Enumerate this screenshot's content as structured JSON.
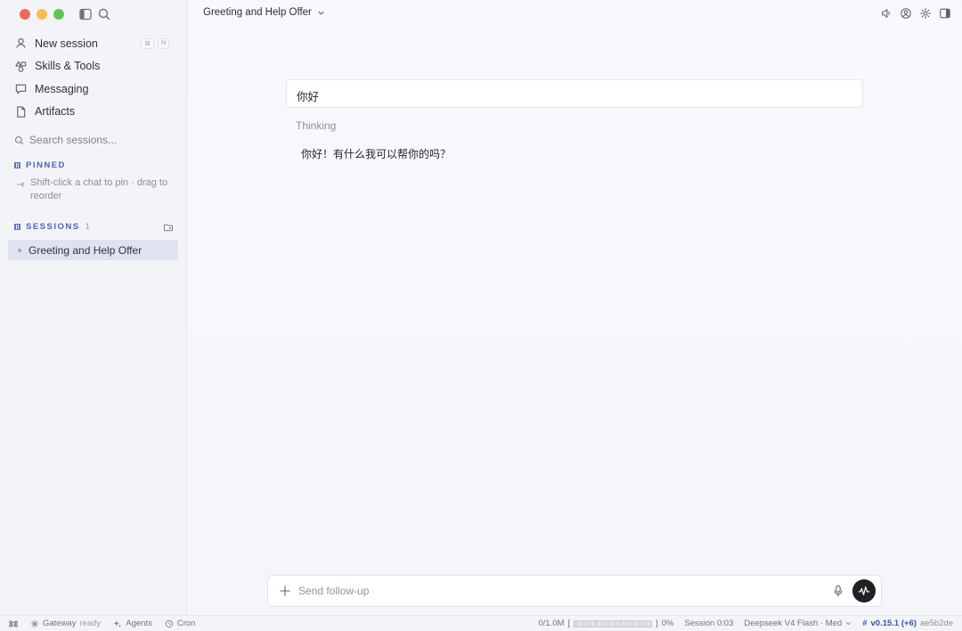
{
  "sidebar": {
    "nav": [
      {
        "label": "New session",
        "icon": "user-icon",
        "shortcut": [
          "⌘",
          "N"
        ]
      },
      {
        "label": "Skills & Tools",
        "icon": "shapes-icon"
      },
      {
        "label": "Messaging",
        "icon": "chat-bubble-icon"
      },
      {
        "label": "Artifacts",
        "icon": "document-icon"
      }
    ],
    "search_placeholder": "Search sessions...",
    "pinned_label": "PINNED",
    "pinned_hint": "Shift-click a chat to pin · drag to reorder",
    "sessions_label": "SESSIONS",
    "sessions_count": "1",
    "sessions": [
      {
        "title": "Greeting and Help Offer"
      }
    ]
  },
  "header": {
    "title": "Greeting and Help Offer"
  },
  "conversation": {
    "user_message": "你好",
    "thinking_label": "Thinking",
    "assistant_reply": "你好！有什么我可以帮你的吗？"
  },
  "composer": {
    "placeholder": "Send follow-up"
  },
  "status_bar": {
    "gateway": "Gateway",
    "gateway_state": "ready",
    "agents": "Agents",
    "cron": "Cron",
    "tokens": "0/1.0M",
    "token_pct": "0%",
    "session_time": "Session 0:03",
    "model": "Deepseek V4 Flash · Med",
    "version": "v0.15.1 (+6)",
    "commit": "ae5b2de"
  },
  "colors": {
    "accent": "#4b64b8",
    "send_button": "#1e2126",
    "selected_session": "#dfe3ef"
  }
}
